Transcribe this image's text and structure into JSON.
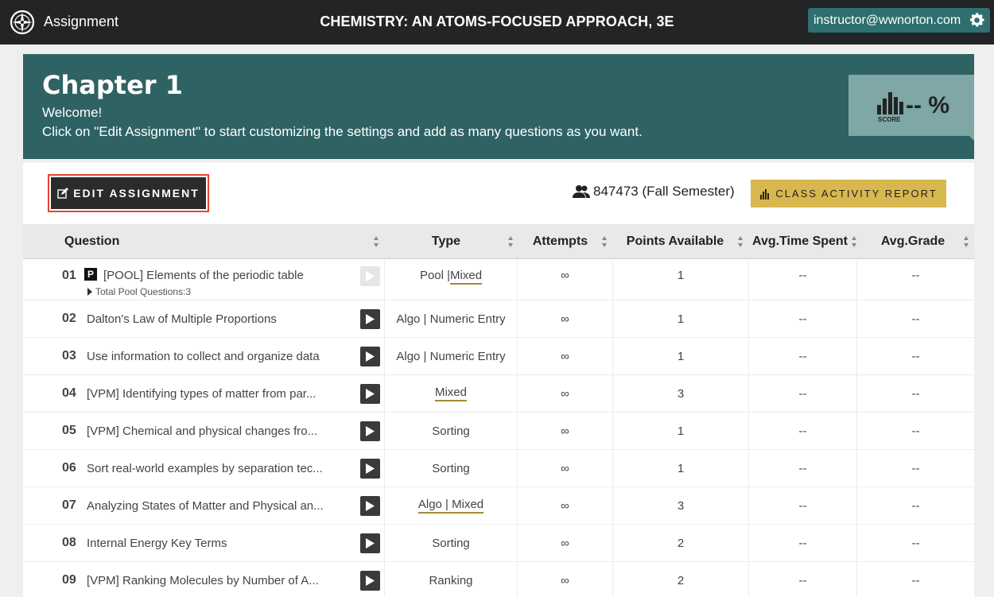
{
  "topbar": {
    "app_title": "Assignment",
    "book_title": "CHEMISTRY: AN ATOMS-FOCUSED APPROACH, 3E",
    "user_email": "instructor@wwnorton.com"
  },
  "banner": {
    "title": "Chapter 1",
    "welcome": "Welcome!",
    "instructions": "Click on \"Edit Assignment\" to start customizing the settings and add as many questions as you want.",
    "score_value": "-- %",
    "score_label": "SCORE"
  },
  "toolbar": {
    "edit_label": "EDIT ASSIGNMENT",
    "section": "847473 (Fall Semester)",
    "report_label": "CLASS ACTIVITY REPORT"
  },
  "table": {
    "headers": {
      "question": "Question",
      "type": "Type",
      "attempts": "Attempts",
      "points": "Points Available",
      "time": "Avg.Time Spent",
      "grade": "Avg.Grade"
    },
    "pool_sub": "Total Pool Questions:3",
    "pool_badge": "P",
    "rows": [
      {
        "num": "01",
        "name": "[POOL] Elements of the periodic table",
        "type_prefix": "Pool | ",
        "type_link": "Mixed",
        "type": "",
        "attempts": "∞",
        "points": "1",
        "time": "--",
        "grade": "--"
      },
      {
        "num": "02",
        "name": "Dalton's Law of Multiple Proportions",
        "type_prefix": "",
        "type_link": "",
        "type": "Algo | Numeric Entry",
        "attempts": "∞",
        "points": "1",
        "time": "--",
        "grade": "--"
      },
      {
        "num": "03",
        "name": "Use information to collect and organize data",
        "type_prefix": "",
        "type_link": "",
        "type": "Algo | Numeric Entry",
        "attempts": "∞",
        "points": "1",
        "time": "--",
        "grade": "--"
      },
      {
        "num": "04",
        "name": "[VPM] Identifying types of matter from par...",
        "type_prefix": "",
        "type_link": "Mixed",
        "type": "",
        "attempts": "∞",
        "points": "3",
        "time": "--",
        "grade": "--"
      },
      {
        "num": "05",
        "name": "[VPM] Chemical and physical changes fro...",
        "type_prefix": "",
        "type_link": "",
        "type": "Sorting",
        "attempts": "∞",
        "points": "1",
        "time": "--",
        "grade": "--"
      },
      {
        "num": "06",
        "name": "Sort real-world examples by separation tec...",
        "type_prefix": "",
        "type_link": "",
        "type": "Sorting",
        "attempts": "∞",
        "points": "1",
        "time": "--",
        "grade": "--"
      },
      {
        "num": "07",
        "name": "Analyzing States of Matter and Physical an...",
        "type_prefix": "",
        "type_link": "Algo | Mixed",
        "type": "",
        "attempts": "∞",
        "points": "3",
        "time": "--",
        "grade": "--"
      },
      {
        "num": "08",
        "name": "Internal Energy Key Terms",
        "type_prefix": "",
        "type_link": "",
        "type": "Sorting",
        "attempts": "∞",
        "points": "2",
        "time": "--",
        "grade": "--"
      },
      {
        "num": "09",
        "name": "[VPM] Ranking Molecules by Number of A...",
        "type_prefix": "",
        "type_link": "",
        "type": "Ranking",
        "attempts": "∞",
        "points": "2",
        "time": "--",
        "grade": "--"
      }
    ]
  }
}
